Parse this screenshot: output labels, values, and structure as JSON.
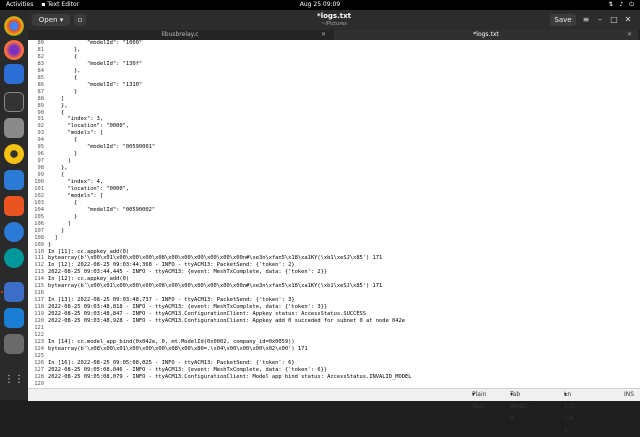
{
  "topbar": {
    "activities": "Activities",
    "app_menu": "Text Editor",
    "clock": "Aug 25  09:09"
  },
  "header": {
    "open_label": "Open",
    "title": "*logs.txt",
    "subtitle": "~/Pictures",
    "save_label": "Save"
  },
  "tabs": [
    {
      "label": "libusbrelay.c",
      "active": false
    },
    {
      "label": "*logs.txt",
      "active": true
    }
  ],
  "lines": [
    {
      "n": "80",
      "t": "            \"modelId\": \"1000\""
    },
    {
      "n": "81",
      "t": "        },"
    },
    {
      "n": "82",
      "t": "        {"
    },
    {
      "n": "83",
      "t": "            \"modelId\": \"130f\""
    },
    {
      "n": "84",
      "t": "        },"
    },
    {
      "n": "85",
      "t": "        {"
    },
    {
      "n": "86",
      "t": "            \"modelId\": \"1310\""
    },
    {
      "n": "87",
      "t": "        }"
    },
    {
      "n": "88",
      "t": "    ]"
    },
    {
      "n": "89",
      "t": "    },"
    },
    {
      "n": "90",
      "t": "    {"
    },
    {
      "n": "91",
      "t": "      \"index\": 3,"
    },
    {
      "n": "92",
      "t": "      \"location\": \"0000\","
    },
    {
      "n": "93",
      "t": "      \"models\": ["
    },
    {
      "n": "94",
      "t": "        {"
    },
    {
      "n": "95",
      "t": "            \"modelId\": \"00590001\""
    },
    {
      "n": "96",
      "t": "        }"
    },
    {
      "n": "97",
      "t": "      ]"
    },
    {
      "n": "98",
      "t": "    },"
    },
    {
      "n": "99",
      "t": "    {"
    },
    {
      "n": "100",
      "t": "      \"index\": 4,"
    },
    {
      "n": "101",
      "t": "      \"location\": \"0000\","
    },
    {
      "n": "102",
      "t": "      \"models\": ["
    },
    {
      "n": "103",
      "t": "        {"
    },
    {
      "n": "104",
      "t": "            \"modelId\": \"00590002\""
    },
    {
      "n": "105",
      "t": "        }"
    },
    {
      "n": "106",
      "t": "      ]"
    },
    {
      "n": "107",
      "t": "    }"
    },
    {
      "n": "108",
      "t": "  ]"
    },
    {
      "n": "109",
      "t": "}"
    },
    {
      "n": "110",
      "t": "In [11]: cc.appkey_add(0)"
    },
    {
      "n": "111",
      "t": "bytearray(b'\\x00\\x01\\x00\\x00\\x00\\x08\\x00\\x00\\x00\\x00\\x00\\x00n#\\xe3n\\xfan5\\x18\\xa1KY(\\xb1\\xeSJ\\x85') 171"
    },
    {
      "n": "112",
      "t": "In [12]: 2022-08-25 09:03:44,368 - INFO - ttyACM13: PacketSend: {'token': 2}"
    },
    {
      "n": "113",
      "t": "2022-08-25 09:03:44,445 - INFO - ttyACM13: {event: MeshTxComplete, data: {'token': 2}}"
    },
    {
      "n": "114",
      "t": "In [12]: cc.appkey_add(0)"
    },
    {
      "n": "115",
      "t": "bytearray(b'\\x00\\x01\\x00\\x00\\x00\\x08\\x00\\x00\\x00\\x00\\x00\\x00n#\\xe3n\\xfan5\\x18\\xa1KY(\\xb1\\xeSJ\\x85') 171"
    },
    {
      "n": "116",
      "t": ""
    },
    {
      "n": "117",
      "t": "In [13]: 2022-08-25 09:03:48,737 - INFO - ttyACM13: PacketSend: {'token': 3}"
    },
    {
      "n": "118",
      "t": "2022-08-25 09:03:48,818 - INFO - ttyACM13: {event: MeshTxComplete, data: {'token': 3}}"
    },
    {
      "n": "119",
      "t": "2022-08-25 09:03:48,847 - INFO - ttyACM13.ConfigurationClient: Appkey status: AccessStatus.SUCCESS"
    },
    {
      "n": "120",
      "t": "2022-08-25 09:03:48,928 - INFO - ttyACM13.ConfigurationClient: Appkey add 0 succeded for subnet 0 at node 042e"
    },
    {
      "n": "121",
      "t": ""
    },
    {
      "n": "122",
      "t": ""
    },
    {
      "n": "123",
      "t": "In [14]: cc.model_app_bind(0x042e, 0, mt.ModelId(0x0002, company_id=0x0059))"
    },
    {
      "n": "124",
      "t": "bytearray(b'\\x08\\x00\\x01\\x00\\x00\\x00\\x08\\x00\\x80=.\\x04\\x00\\x00\\x00\\x02\\x00') 171"
    },
    {
      "n": "125",
      "t": ""
    },
    {
      "n": "126",
      "t": "In [16]: 2022-08-25 09:05:08,025 - INFO - ttyACM13: PacketSend: {'token': 6}"
    },
    {
      "n": "127",
      "t": "2022-08-25 09:05:08,046 - INFO - ttyACM13: {event: MeshTxComplete, data: {'token': 6}}"
    },
    {
      "n": "128",
      "t": "2022-08-25 09:05:08,079 - INFO - ttyACM13.ConfigurationClient: Model app bind status: AccessStatus.INVALID_MODEL"
    },
    {
      "n": "129",
      "t": ""
    },
    {
      "n": "130",
      "t": ""
    }
  ],
  "statusbar": {
    "syntax": "Plain Text",
    "tab_width": "Tab Width: 8",
    "position": "Ln 130, Col 1",
    "mode": "INS"
  }
}
